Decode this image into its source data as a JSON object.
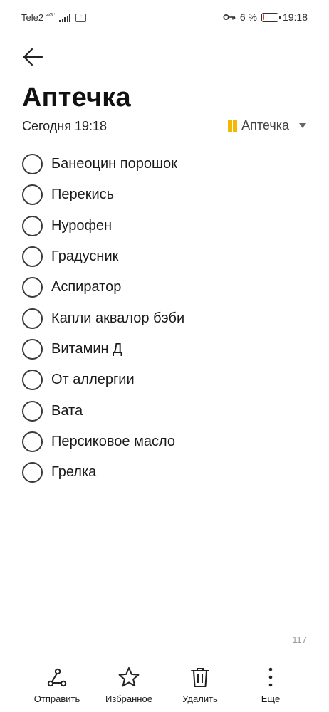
{
  "status_bar": {
    "carrier": "Tele2",
    "network": "4G⁺",
    "battery_percent": "6 %",
    "battery_level": 0.06,
    "battery_color": "#e53935",
    "time": "19:18"
  },
  "header": {
    "title": "Аптечка",
    "datetime": "Сегодня 19:18",
    "category": "Аптечка",
    "category_color": "#f5b800"
  },
  "checklist": [
    {
      "text": "Банеоцин порошок",
      "checked": false
    },
    {
      "text": "Перекись",
      "checked": false
    },
    {
      "text": "Нурофен",
      "checked": false
    },
    {
      "text": "Градусник",
      "checked": false
    },
    {
      "text": "Аспиратор",
      "checked": false
    },
    {
      "text": "Капли аквалор бэби",
      "checked": false
    },
    {
      "text": "Витамин Д",
      "checked": false
    },
    {
      "text": "От аллергии",
      "checked": false
    },
    {
      "text": "Вата",
      "checked": false
    },
    {
      "text": "Персиковое масло",
      "checked": false
    },
    {
      "text": "Грелка",
      "checked": false
    }
  ],
  "char_count": "117",
  "bottom_bar": {
    "share_label": "Отправить",
    "favorite_label": "Избранное",
    "delete_label": "Удалить",
    "more_label": "Еще"
  },
  "icons": {
    "back": "arrow-left-icon",
    "share": "share-icon",
    "favorite": "star-icon",
    "delete": "trash-icon",
    "more": "more-vertical-icon",
    "key": "key-icon",
    "category": "folder-icon"
  }
}
